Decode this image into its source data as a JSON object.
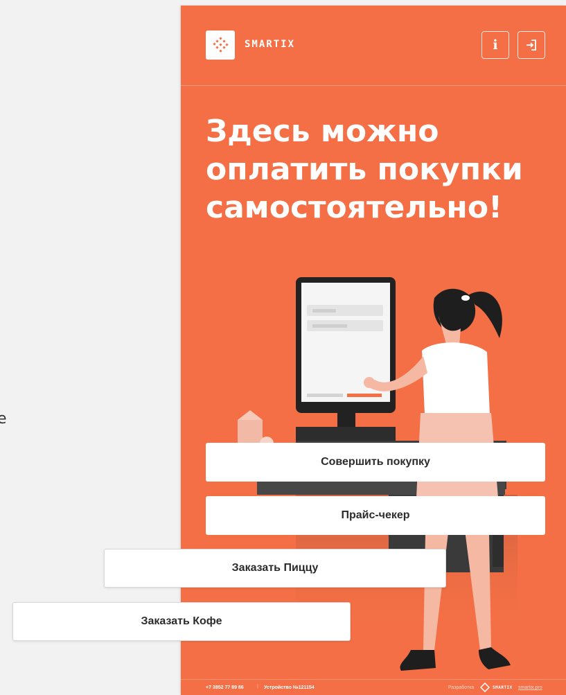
{
  "left_edge_glyph": "e",
  "header": {
    "brand": "SMARTIX",
    "info_label": "i"
  },
  "headline": {
    "line1": "Здесь можно",
    "line2": "оплатить покупки",
    "line3": "самостоятельно!"
  },
  "actions": {
    "buy": "Совершить покупку",
    "price_checker": "Прайс-чекер",
    "order_pizza": "Заказать Пиццу",
    "order_coffee": "Заказать Кофе"
  },
  "footer": {
    "phone": "+7 3852 77 89 86",
    "separator": "|",
    "device": "Устройство №121154",
    "dev_label": "Разработка",
    "dev_brand": "SMARTIX",
    "dev_site": "smartix.pro"
  },
  "colors": {
    "accent": "#f46f45",
    "background": "#f2f2f2",
    "button_bg": "#ffffff",
    "button_text": "#2b2b2b"
  },
  "icons": {
    "logo": "smartix-logo-icon",
    "info": "info-icon",
    "login": "login-icon"
  }
}
